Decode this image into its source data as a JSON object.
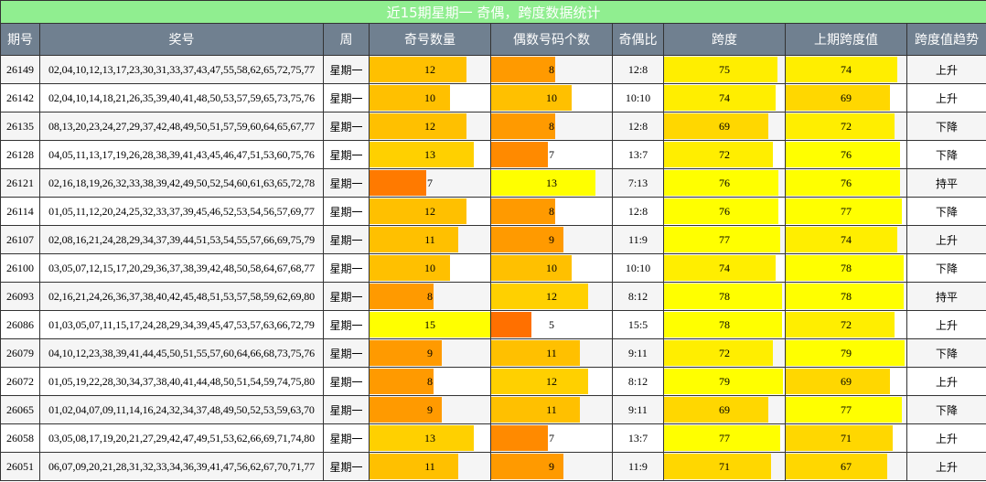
{
  "title": "近15期星期一 奇偶，跨度数据统计",
  "headers": [
    "期号",
    "奖号",
    "周",
    "奇号数量",
    "偶数号码个数",
    "奇偶比",
    "跨度",
    "上期跨度值",
    "跨度值趋势"
  ],
  "colors": {
    "title_bg": "#90ee90",
    "header_bg": "#708090",
    "bar_yellow": "#ffff00",
    "bar_gold": "#ffd700",
    "bar_amber": "#ffc000",
    "bar_orange": "#ffa500",
    "bar_dark_orange": "#ff8c00",
    "bar_red_orange": "#ff7000"
  },
  "scale": {
    "odd_even_max": 15,
    "span_max": 80
  },
  "rows": [
    {
      "issue": "26149",
      "numbers": "02,04,10,12,13,17,23,30,31,33,37,43,47,55,58,62,65,72,75,77",
      "weekday": "星期一",
      "odd": 12,
      "even": 8,
      "ratio": "12:8",
      "span": 75,
      "prev_span": 74,
      "trend": "上升"
    },
    {
      "issue": "26142",
      "numbers": "02,04,10,14,18,21,26,35,39,40,41,48,50,53,57,59,65,73,75,76",
      "weekday": "星期一",
      "odd": 10,
      "even": 10,
      "ratio": "10:10",
      "span": 74,
      "prev_span": 69,
      "trend": "上升"
    },
    {
      "issue": "26135",
      "numbers": "08,13,20,23,24,27,29,37,42,48,49,50,51,57,59,60,64,65,67,77",
      "weekday": "星期一",
      "odd": 12,
      "even": 8,
      "ratio": "12:8",
      "span": 69,
      "prev_span": 72,
      "trend": "下降"
    },
    {
      "issue": "26128",
      "numbers": "04,05,11,13,17,19,26,28,38,39,41,43,45,46,47,51,53,60,75,76",
      "weekday": "星期一",
      "odd": 13,
      "even": 7,
      "ratio": "13:7",
      "span": 72,
      "prev_span": 76,
      "trend": "下降"
    },
    {
      "issue": "26121",
      "numbers": "02,16,18,19,26,32,33,38,39,42,49,50,52,54,60,61,63,65,72,78",
      "weekday": "星期一",
      "odd": 7,
      "even": 13,
      "ratio": "7:13",
      "span": 76,
      "prev_span": 76,
      "trend": "持平"
    },
    {
      "issue": "26114",
      "numbers": "01,05,11,12,20,24,25,32,33,37,39,45,46,52,53,54,56,57,69,77",
      "weekday": "星期一",
      "odd": 12,
      "even": 8,
      "ratio": "12:8",
      "span": 76,
      "prev_span": 77,
      "trend": "下降"
    },
    {
      "issue": "26107",
      "numbers": "02,08,16,21,24,28,29,34,37,39,44,51,53,54,55,57,66,69,75,79",
      "weekday": "星期一",
      "odd": 11,
      "even": 9,
      "ratio": "11:9",
      "span": 77,
      "prev_span": 74,
      "trend": "上升"
    },
    {
      "issue": "26100",
      "numbers": "03,05,07,12,15,17,20,29,36,37,38,39,42,48,50,58,64,67,68,77",
      "weekday": "星期一",
      "odd": 10,
      "even": 10,
      "ratio": "10:10",
      "span": 74,
      "prev_span": 78,
      "trend": "下降"
    },
    {
      "issue": "26093",
      "numbers": "02,16,21,24,26,36,37,38,40,42,45,48,51,53,57,58,59,62,69,80",
      "weekday": "星期一",
      "odd": 8,
      "even": 12,
      "ratio": "8:12",
      "span": 78,
      "prev_span": 78,
      "trend": "持平"
    },
    {
      "issue": "26086",
      "numbers": "01,03,05,07,11,15,17,24,28,29,34,39,45,47,53,57,63,66,72,79",
      "weekday": "星期一",
      "odd": 15,
      "even": 5,
      "ratio": "15:5",
      "span": 78,
      "prev_span": 72,
      "trend": "上升"
    },
    {
      "issue": "26079",
      "numbers": "04,10,12,23,38,39,41,44,45,50,51,55,57,60,64,66,68,73,75,76",
      "weekday": "星期一",
      "odd": 9,
      "even": 11,
      "ratio": "9:11",
      "span": 72,
      "prev_span": 79,
      "trend": "下降"
    },
    {
      "issue": "26072",
      "numbers": "01,05,19,22,28,30,34,37,38,40,41,44,48,50,51,54,59,74,75,80",
      "weekday": "星期一",
      "odd": 8,
      "even": 12,
      "ratio": "8:12",
      "span": 79,
      "prev_span": 69,
      "trend": "上升"
    },
    {
      "issue": "26065",
      "numbers": "01,02,04,07,09,11,14,16,24,32,34,37,48,49,50,52,53,59,63,70",
      "weekday": "星期一",
      "odd": 9,
      "even": 11,
      "ratio": "9:11",
      "span": 69,
      "prev_span": 77,
      "trend": "下降"
    },
    {
      "issue": "26058",
      "numbers": "03,05,08,17,19,20,21,27,29,42,47,49,51,53,62,66,69,71,74,80",
      "weekday": "星期一",
      "odd": 13,
      "even": 7,
      "ratio": "13:7",
      "span": 77,
      "prev_span": 71,
      "trend": "上升"
    },
    {
      "issue": "26051",
      "numbers": "06,07,09,20,21,28,31,32,33,34,36,39,41,47,56,62,67,70,71,77",
      "weekday": "星期一",
      "odd": 11,
      "even": 9,
      "ratio": "11:9",
      "span": 71,
      "prev_span": 67,
      "trend": "上升"
    }
  ]
}
